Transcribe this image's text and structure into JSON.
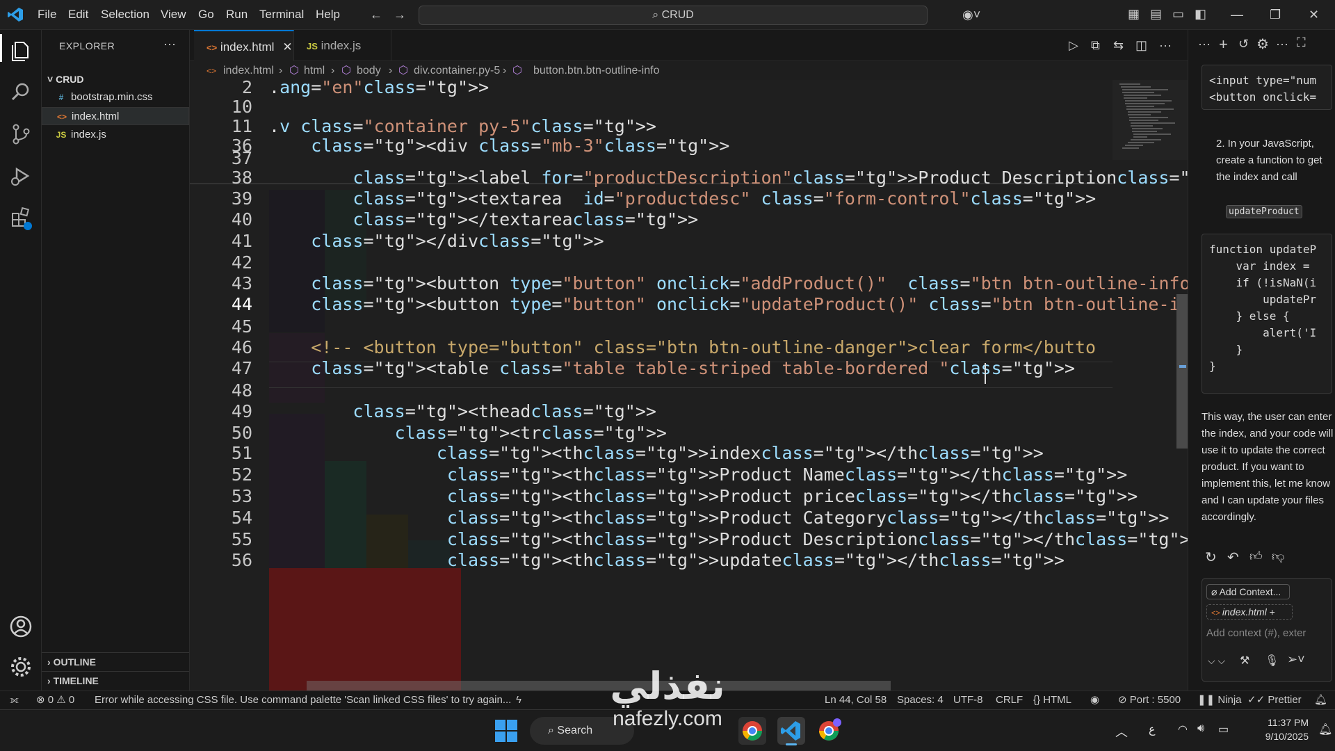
{
  "menu": [
    "File",
    "Edit",
    "Selection",
    "View",
    "Go",
    "Run",
    "Terminal",
    "Help"
  ],
  "command_center": "CRUD",
  "explorer": {
    "title": "EXPLORER",
    "folder": "CRUD",
    "files": [
      {
        "name": "bootstrap.min.css",
        "icon": "#"
      },
      {
        "name": "index.html",
        "icon": "<>"
      },
      {
        "name": "index.js",
        "icon": "JS"
      }
    ],
    "outline": "OUTLINE",
    "timeline": "TIMELINE"
  },
  "tabs": [
    {
      "label": "index.html",
      "icon": "<>"
    },
    {
      "label": "index.js",
      "icon": "JS"
    }
  ],
  "breadcrumb": [
    "index.html",
    "html",
    "body",
    "div.container.py-5",
    "button.btn.btn-outline-info"
  ],
  "editor": {
    "line_numbers": [
      "2",
      "10",
      "11",
      "36",
      "37",
      "38",
      "39",
      "40",
      "41",
      "42",
      "43",
      "44",
      "45",
      "46",
      "47",
      "48",
      "49",
      "50",
      "51",
      "52",
      "53",
      "54",
      "55",
      "56"
    ]
  },
  "chat": {
    "snippet1": "<input type=\"num\n<button onclick=",
    "step2": "2. In your JavaScript, create a function to get the index and call",
    "step2_code": "updateProduct",
    "snippet2": "function updateP\n    var index =\n    if (!isNaN(i\n        updatePr\n    } else {\n        alert('I\n    }\n}",
    "paragraph": "This way, the user can enter the index, and your code will use it to update the correct product. If you want to implement this, let me know and I can update your files accordingly.",
    "add_context": "Add Context...",
    "context_file": "index.html",
    "input_placeholder": "Add context (#), exter"
  },
  "status": {
    "errors": "0",
    "warnings": "0",
    "message": "Error while accessing CSS file. Use command palette 'Scan linked CSS files' to try again...",
    "position": "Ln 44, Col 58",
    "spaces": "Spaces: 4",
    "encoding": "UTF-8",
    "eol": "CRLF",
    "language": "HTML",
    "port": "Port : 5500",
    "ninja": "Ninja",
    "prettier": "Prettier"
  },
  "taskbar": {
    "search": "Search",
    "time": "11:37 PM",
    "date": "9/10/2025",
    "lang": "ع"
  },
  "watermark": {
    "arabic": "نفذلي",
    "domain": "nafezly.com"
  }
}
